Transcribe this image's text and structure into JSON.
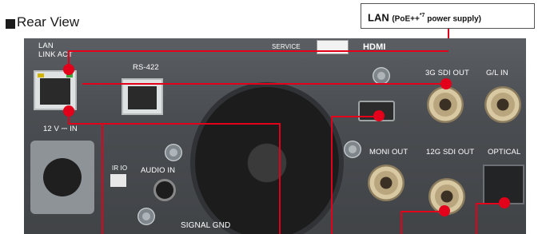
{
  "title": "Rear View",
  "callout": {
    "main": "LAN ",
    "small": "(PoE++",
    "sup": "*7",
    "small_end": " power supply)"
  },
  "labels": {
    "lan_link_act": "LAN\nLINK ACT",
    "rs422": "RS-422",
    "service": "SERVICE",
    "hdmi": "HDMI",
    "sdi3g_out": "3G SDI OUT",
    "gl_in": "G/L IN",
    "dc_in": "12 V ⎓ IN",
    "ir_io": "IR IO",
    "audio_in": "AUDIO IN",
    "moni_out": "MONI OUT",
    "sdi12g_out": "12G SDI OUT",
    "optical": "OPTICAL",
    "signal_gnd": "SIGNAL GND"
  },
  "colors": {
    "accent": "#e2001a",
    "panel": "#4a4d51"
  }
}
